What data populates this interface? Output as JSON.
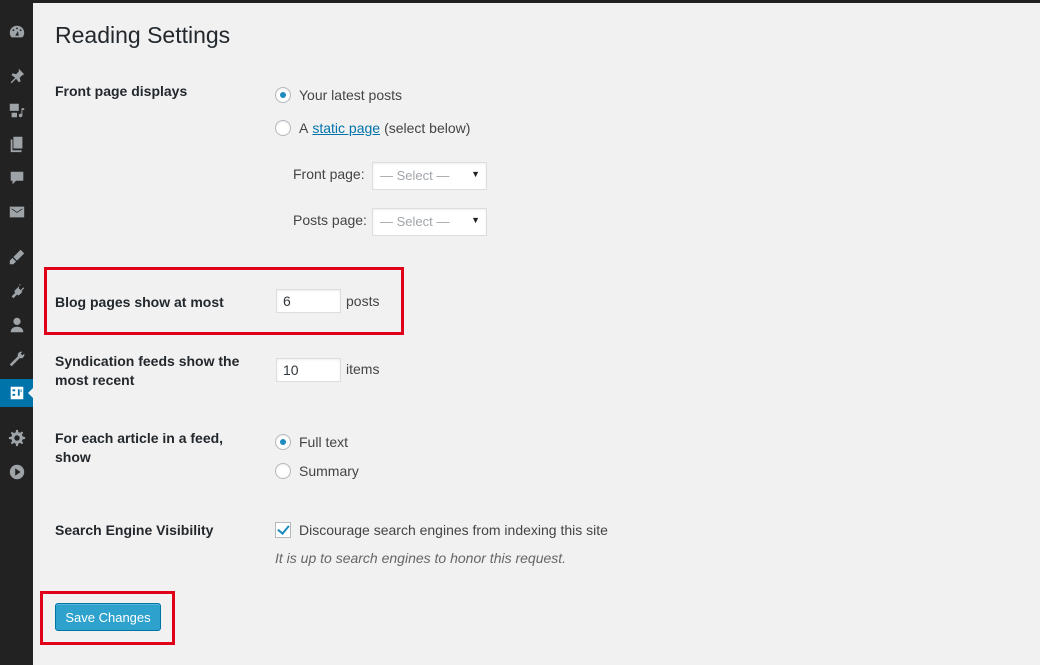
{
  "page": {
    "title": "Reading Settings"
  },
  "sidebar": {
    "items": [
      {
        "icon": "dashboard-icon"
      },
      {
        "icon": "pin-icon"
      },
      {
        "icon": "media-icon"
      },
      {
        "icon": "pages-icon"
      },
      {
        "icon": "comments-icon"
      },
      {
        "icon": "mail-icon"
      },
      {
        "icon": "appearance-icon"
      },
      {
        "icon": "plugins-icon"
      },
      {
        "icon": "users-icon"
      },
      {
        "icon": "tools-icon"
      },
      {
        "icon": "settings-icon",
        "active": true
      },
      {
        "icon": "gear-icon"
      },
      {
        "icon": "play-icon"
      }
    ]
  },
  "front_page": {
    "label": "Front page displays",
    "latest_posts": "Your latest posts",
    "static_prefix": "A",
    "static_link": "static page",
    "static_suffix": "(select below)",
    "selected": "latest_posts",
    "front_page_label": "Front page:",
    "front_page_value": "— Select —",
    "posts_page_label": "Posts page:",
    "posts_page_value": "— Select —"
  },
  "blog_pages": {
    "label": "Blog pages show at most",
    "value": "6",
    "suffix": "posts"
  },
  "syndication": {
    "label": "Syndication feeds show the most recent",
    "value": "10",
    "suffix": "items"
  },
  "feed_article": {
    "label": "For each article in a feed, show",
    "full_text": "Full text",
    "summary": "Summary",
    "selected": "full_text"
  },
  "visibility": {
    "label": "Search Engine Visibility",
    "checkbox_label": "Discourage search engines from indexing this site",
    "checked": true,
    "description": "It is up to search engines to honor this request."
  },
  "actions": {
    "save_label": "Save Changes"
  },
  "colors": {
    "accent": "#0073aa",
    "button": "#2ea2cc",
    "highlight": "#e0001a",
    "sidebar": "#222222"
  }
}
